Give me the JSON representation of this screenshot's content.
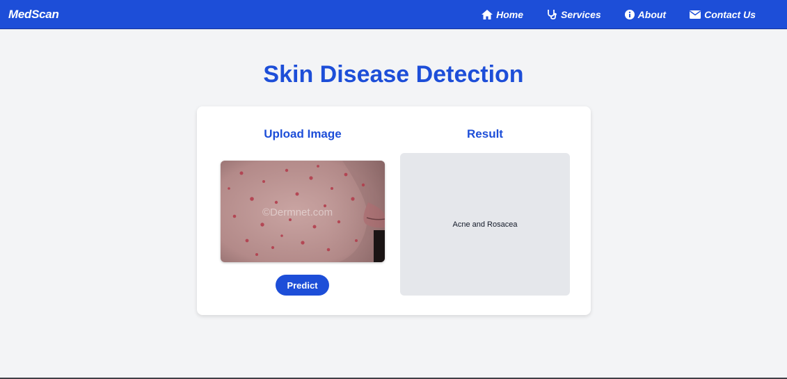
{
  "navbar": {
    "brand": "MedScan",
    "links": [
      {
        "label": "Home",
        "icon": "home-icon"
      },
      {
        "label": "Services",
        "icon": "stethoscope-icon"
      },
      {
        "label": "About",
        "icon": "info-icon"
      },
      {
        "label": "Contact Us",
        "icon": "envelope-icon"
      }
    ]
  },
  "page": {
    "title": "Skin Disease Detection"
  },
  "upload": {
    "heading": "Upload Image",
    "image_watermark": "©Dermnet.com",
    "predict_label": "Predict"
  },
  "result": {
    "heading": "Result",
    "value": "Acne and Rosacea"
  },
  "colors": {
    "primary": "#1d4ed8",
    "background": "#f3f4f6",
    "card": "#ffffff",
    "result_box": "#e5e7eb"
  }
}
